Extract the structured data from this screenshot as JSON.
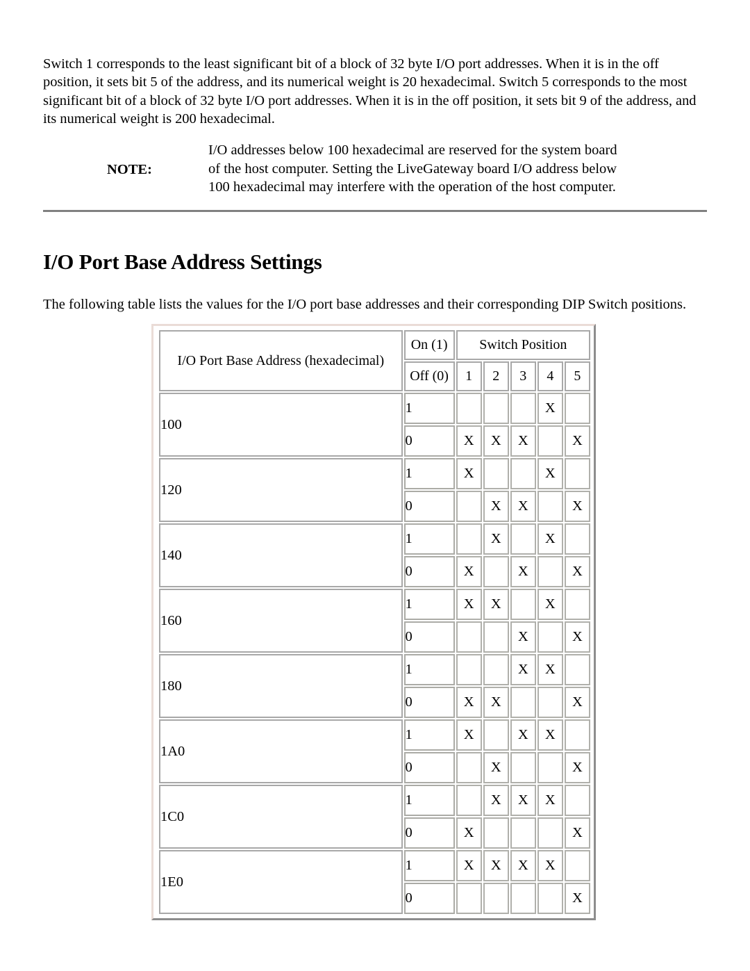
{
  "intro_paragraph": "Switch 1 corresponds to the least significant bit of a block of 32 byte I/O port addresses. When it is in the off position, it sets bit 5 of the address, and its numerical weight is 20 hexadecimal. Switch 5 corresponds to the most significant bit of a block of 32 byte I/O port addresses. When it is in the off position, it sets bit 9 of the address, and its numerical weight is 200 hexadecimal.",
  "note": {
    "label": "NOTE:",
    "lines": [
      "I/O addresses below 100 hexadecimal are reserved for the system board",
      "of the host computer. Setting the LiveGateway board I/O address below",
      "100 hexadecimal may interfere with the operation of the host computer."
    ]
  },
  "section": {
    "heading": "I/O Port Base Address Settings",
    "body_paragraph": "The following table lists the values for the I/O port base addresses and their corresponding DIP Switch positions."
  },
  "table": {
    "address_header": "I/O Port Base Address (hexadecimal)",
    "on_label": "On (1)",
    "off_label": "Off (0)",
    "switch_position_header": "Switch Position",
    "switch_numbers": [
      "1",
      "2",
      "3",
      "4",
      "5"
    ],
    "mark": "X",
    "rows": [
      {
        "address": "100",
        "on": {
          "state": "1",
          "cells": [
            "",
            "",
            "",
            "X",
            ""
          ]
        },
        "off": {
          "state": "0",
          "cells": [
            "X",
            "X",
            "X",
            "",
            "X"
          ]
        }
      },
      {
        "address": "120",
        "on": {
          "state": "1",
          "cells": [
            "X",
            "",
            "",
            "X",
            ""
          ]
        },
        "off": {
          "state": "0",
          "cells": [
            "",
            "X",
            "X",
            "",
            "X"
          ]
        }
      },
      {
        "address": "140",
        "on": {
          "state": "1",
          "cells": [
            "",
            "X",
            "",
            "X",
            ""
          ]
        },
        "off": {
          "state": "0",
          "cells": [
            "X",
            "",
            "X",
            "",
            "X"
          ]
        }
      },
      {
        "address": "160",
        "on": {
          "state": "1",
          "cells": [
            "X",
            "X",
            "",
            "X",
            ""
          ]
        },
        "off": {
          "state": "0",
          "cells": [
            "",
            "",
            "X",
            "",
            "X"
          ]
        }
      },
      {
        "address": "180",
        "on": {
          "state": "1",
          "cells": [
            "",
            "",
            "X",
            "X",
            ""
          ]
        },
        "off": {
          "state": "0",
          "cells": [
            "X",
            "X",
            "",
            "",
            "X"
          ]
        }
      },
      {
        "address": "1A0",
        "on": {
          "state": "1",
          "cells": [
            "X",
            "",
            "X",
            "X",
            ""
          ]
        },
        "off": {
          "state": "0",
          "cells": [
            "",
            "X",
            "",
            "",
            "X"
          ]
        }
      },
      {
        "address": "1C0",
        "on": {
          "state": "1",
          "cells": [
            "",
            "X",
            "X",
            "X",
            ""
          ]
        },
        "off": {
          "state": "0",
          "cells": [
            "X",
            "",
            "",
            "",
            "X"
          ]
        }
      },
      {
        "address": "1E0",
        "on": {
          "state": "1",
          "cells": [
            "X",
            "X",
            "X",
            "X",
            ""
          ]
        },
        "off": {
          "state": "0",
          "cells": [
            "",
            "",
            "",
            "",
            "X"
          ]
        }
      }
    ]
  },
  "colors": {
    "text": "#000000",
    "rule": "#808080",
    "table_outer_border": "#eadcd7",
    "cell_border": "#a8a8a8"
  }
}
